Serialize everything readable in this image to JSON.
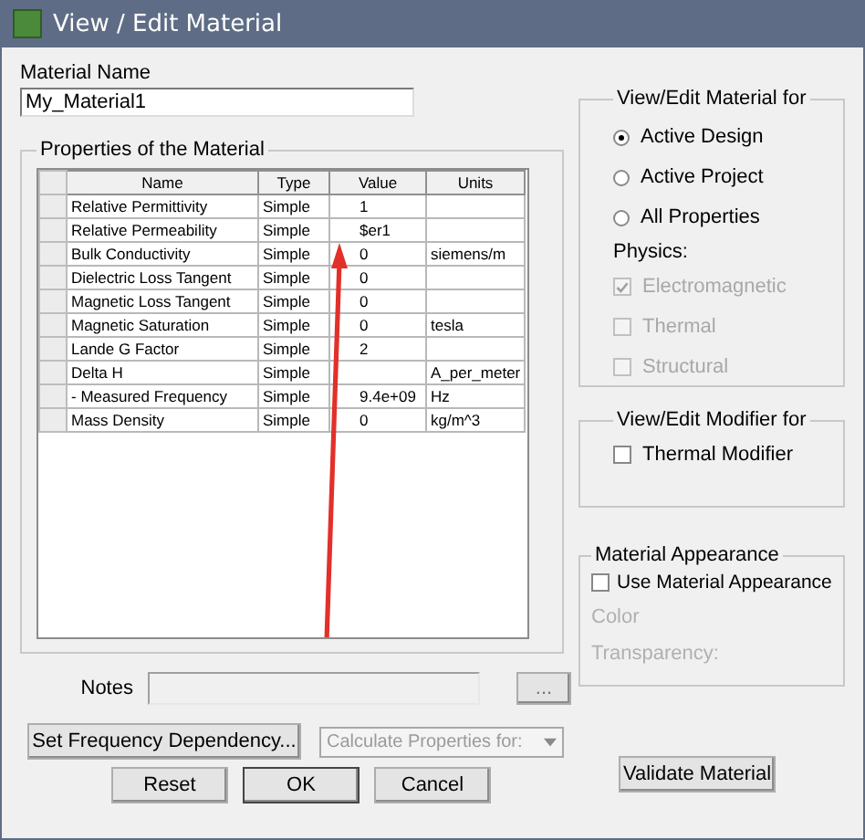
{
  "window": {
    "title": "View / Edit Material"
  },
  "material_name": {
    "label": "Material Name",
    "value": "My_Material1"
  },
  "properties": {
    "title": "Properties of the Material",
    "columns": [
      "Name",
      "Type",
      "Value",
      "Units"
    ],
    "rows": [
      {
        "name": "Relative Permittivity",
        "type": "Simple",
        "value": "1"
      },
      {
        "name": "Relative Permeability",
        "type": "Simple",
        "value": "$er1"
      },
      {
        "name": "Bulk Conductivity",
        "type": "Simple",
        "value": "0",
        "units": "siemens/m"
      },
      {
        "name": "Dielectric Loss Tangent",
        "type": "Simple",
        "value": "0"
      },
      {
        "name": "Magnetic Loss Tangent",
        "type": "Simple",
        "value": "0"
      },
      {
        "name": "Magnetic Saturation",
        "type": "Simple",
        "value": "0",
        "units": "tesla"
      },
      {
        "name": "Lande G Factor",
        "type": "Simple",
        "value": "2"
      },
      {
        "name": "Delta H",
        "type": "Simple",
        "units": "A_per_meter"
      },
      {
        "name": "- Measured Frequency",
        "type": "Simple",
        "value": "9.4e+09",
        "units": "Hz"
      },
      {
        "name": "Mass Density",
        "type": "Simple",
        "value": "0",
        "units": "kg/m^3"
      }
    ]
  },
  "view_edit_for": {
    "title": "View/Edit Material for",
    "options": [
      {
        "label": "Active Design",
        "selected": true
      },
      {
        "label": "Active Project",
        "selected": false
      },
      {
        "label": "All Properties",
        "selected": false
      }
    ],
    "physics_label": "Physics:",
    "physics": [
      {
        "label": "Electromagnetic",
        "checked": true,
        "disabled": true
      },
      {
        "label": "Thermal",
        "checked": false,
        "disabled": true
      },
      {
        "label": "Structural",
        "checked": false,
        "disabled": true
      }
    ]
  },
  "modifier": {
    "title": "View/Edit Modifier for",
    "checkbox": {
      "label": "Thermal Modifier",
      "checked": false
    }
  },
  "appearance": {
    "title": "Material Appearance",
    "checkbox": {
      "label": "Use Material Appearance",
      "checked": false
    },
    "color_label": "Color",
    "transparency_label": "Transparency:"
  },
  "notes": {
    "label": "Notes",
    "button": "..."
  },
  "frequency_button": "Set Frequency Dependency...",
  "calculate_combo": {
    "placeholder": "Calculate Properties for:",
    "disabled": true
  },
  "buttons": [
    "Reset",
    "OK",
    "Cancel"
  ],
  "validate_button": "Validate Material"
}
